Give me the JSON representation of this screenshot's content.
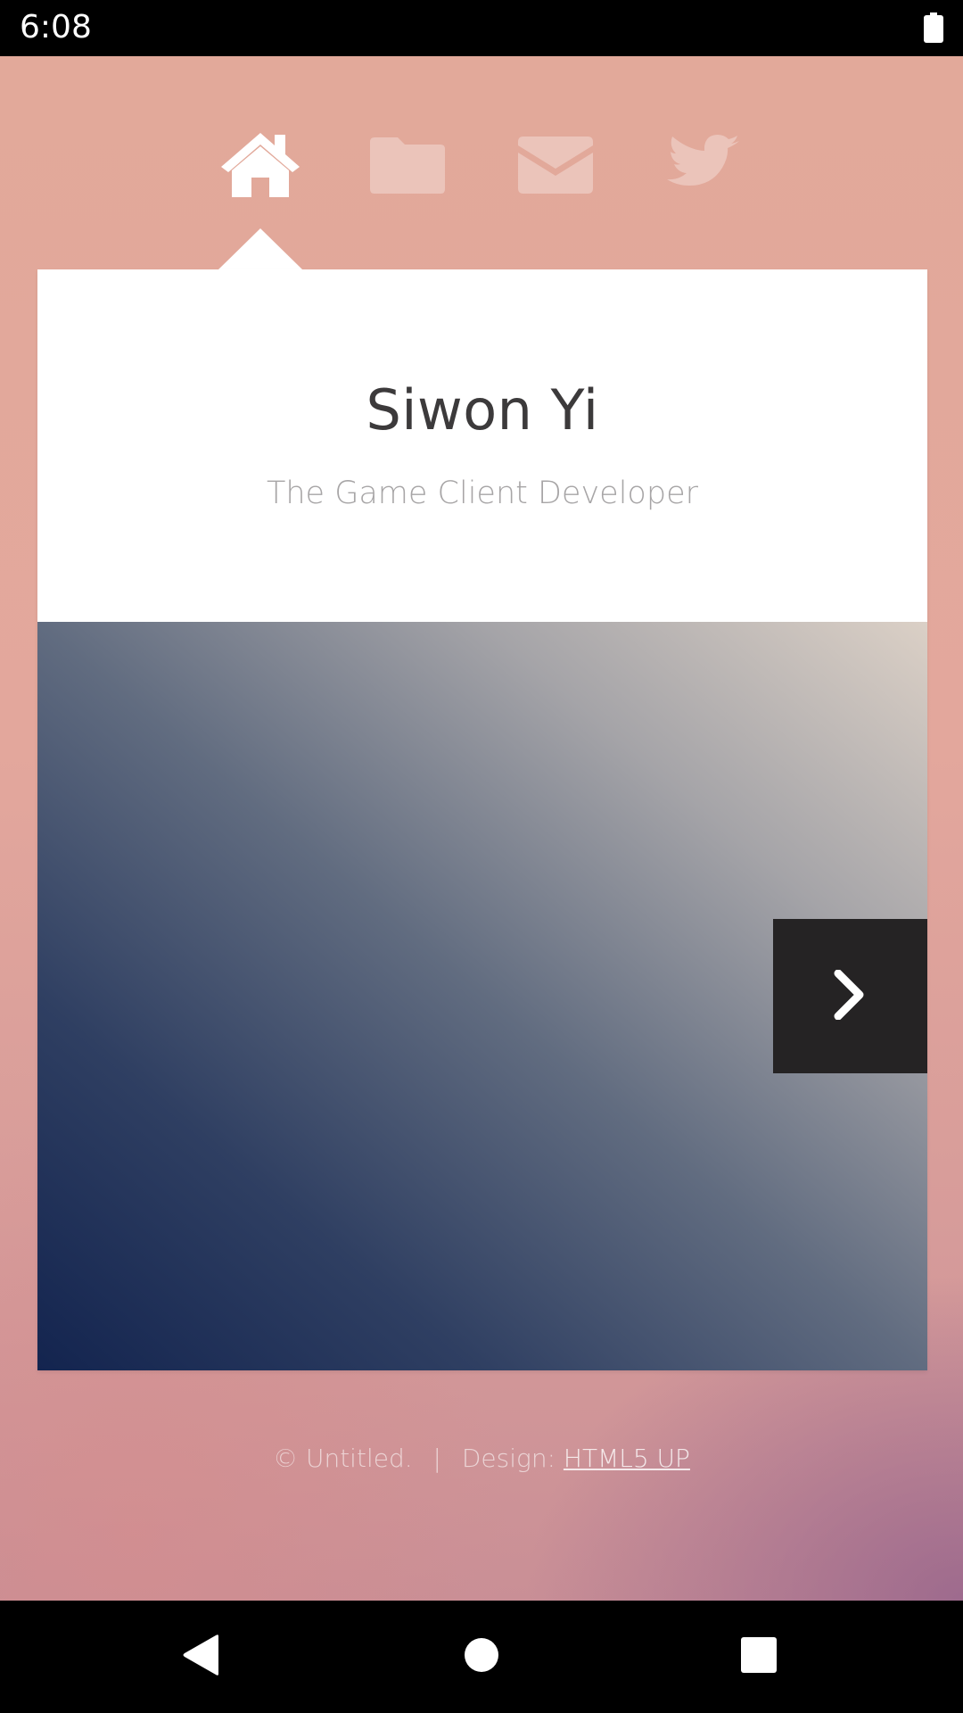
{
  "status_bar": {
    "time": "6:08",
    "battery_icon": "battery-full-icon"
  },
  "nav": {
    "items": [
      {
        "icon": "home-icon",
        "active": true
      },
      {
        "icon": "folder-icon",
        "active": false
      },
      {
        "icon": "envelope-icon",
        "active": false
      },
      {
        "icon": "twitter-bird-icon",
        "active": false
      }
    ]
  },
  "card": {
    "title": "Siwon Yi",
    "subtitle": "The Game Client Developer",
    "next_icon": "chevron-right-icon"
  },
  "footer": {
    "copyright": "© Untitled.",
    "separator": "|",
    "design_label": "Design:",
    "design_link": "HTML5 UP"
  },
  "system_nav": {
    "back_icon": "back-triangle-icon",
    "home_icon": "home-circle-icon",
    "recents_icon": "recents-square-icon"
  },
  "colors": {
    "page_background": "#e2a99b",
    "card_background": "#ffffff",
    "title_color": "#3c3a3b",
    "subtitle_color": "#a7a5a6",
    "next_button_background": "#252324"
  }
}
